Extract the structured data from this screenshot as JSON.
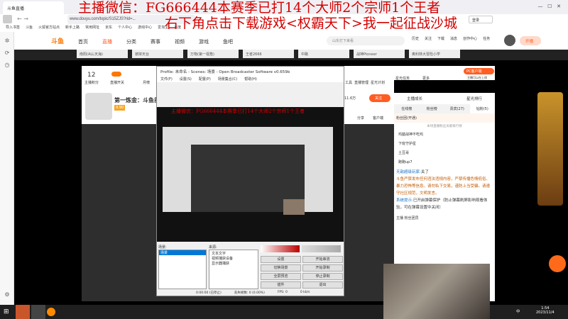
{
  "browser": {
    "tab_title": "斗鱼直播",
    "url": "www.douyu.com/topic/S15ZJS?rid=...",
    "bookmarks": [
      "导入书签",
      "斗鱼",
      "火狐官方站点",
      "新手上路",
      "常用网址",
      "京东",
      "个人中心",
      "游戏中心",
      "爱淘宝",
      "百度"
    ],
    "sync_label": "登录"
  },
  "overlay": {
    "line1": "主播微信：FG666444本赛季已打14个大师2个宗师1个王者",
    "line2": "右下角点击下载游戏<权霸天下>我一起征战沙城"
  },
  "douyu": {
    "logo": "斗鱼",
    "nav": [
      "首页",
      "直播",
      "分类",
      "赛事",
      "视频",
      "游戏",
      "鱼吧"
    ],
    "search_placeholder": "山东打下来看",
    "icons": [
      "历史",
      "关注",
      "下载",
      "消息",
      "创作中心",
      "任务"
    ],
    "start_live": "开播",
    "categories": [
      "南阳(ALL天海)",
      "彼岸天台",
      "万物(第一视角)",
      "王者2666",
      "中路",
      "战神Pioneer",
      "奥利林大冒险小学"
    ]
  },
  "room": {
    "level": "12",
    "level_label": "主播积分",
    "stats": [
      "直播开关",
      "月榜"
    ],
    "title": "第一炼金：斗鱼前",
    "score": "9.90",
    "follow_count": "11.6万",
    "follow_label": "关注",
    "share": "分享",
    "client": "客户端",
    "right_tools": [
      "工具",
      "直播管理",
      "星光计划"
    ],
    "ad_label": "星光任务",
    "more_label": "更多",
    "pc_client": "PC客户端",
    "pc_sub": "主播可以在上线"
  },
  "chat": {
    "rank_links": [
      "主播成长",
      "星光排行"
    ],
    "tabs": [
      "在线榜",
      "粉丝榜",
      "贵宾(27)",
      "钻粉(5)"
    ],
    "fan_label": "粉丝团(开通)",
    "rank_note": "本场直播粉丝贡献排行榜",
    "ranks": [
      "鸡腿战神不吃鸡",
      "下班守护星",
      "土豆哥",
      "跑跑up7"
    ],
    "messages": [
      {
        "user": "无敌超级玩家:",
        "text": "关了"
      },
      {
        "user": "",
        "text": "斗鱼严禁发布任何违法违规内容，严禁传播色情低俗、暴力恐怖等信息。请勿私下交易，谨防上当受骗。请遵守社区规范，文明发言。"
      },
      {
        "user": "系统提示:",
        "text": "已开启弹幕保护（防止弹幕刷屏影响观看体验，可在弹幕设置中关闭）"
      }
    ],
    "user_tag": "主播",
    "user_badge": "粉丝团员"
  },
  "obs": {
    "title": "Profile: 未命名 - Scenes: 场景 - Open Broadcaster Software v0.659b",
    "menu": [
      "文件(F)",
      "设置(S)",
      "配置(P)",
      "场景集合(C)",
      "帮助(H)"
    ],
    "scenes_label": "场景:",
    "scenes": [
      "场景"
    ],
    "sources_label": "来源:",
    "sources": [
      "文本文字",
      "视频捕获设备",
      "显示器捕获"
    ],
    "buttons": [
      "设置",
      "开始串流",
      "切换场景",
      "开始录制",
      "全屏预览",
      "停止录制",
      "插件",
      "退出"
    ],
    "status": [
      "0:00:00 (已停止)",
      "丢失帧数: 0 (0.00%)",
      "FPS: 0",
      "0 kb/s"
    ]
  },
  "taskbar": {
    "time": "1:54",
    "date": "2023/11/4",
    "ime": "中"
  }
}
